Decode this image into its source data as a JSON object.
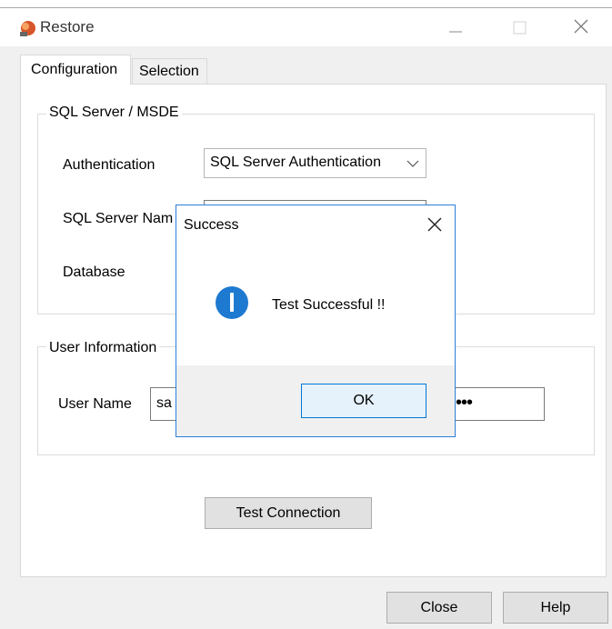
{
  "window": {
    "title": "Restore"
  },
  "tabs": {
    "configuration": "Configuration",
    "selection": "Selection"
  },
  "sql_group": {
    "title": "SQL Server / MSDE",
    "auth_label": "Authentication",
    "auth_value": "SQL Server Authentication",
    "server_label": "SQL Server Nam",
    "database_label": "Database"
  },
  "user_group": {
    "title": "User Information",
    "username_label": "User Name",
    "username_value": "sa",
    "password_value": "•••"
  },
  "buttons": {
    "test_connection": "Test Connection",
    "close": "Close",
    "help": "Help"
  },
  "dialog": {
    "title": "Success",
    "message": "Test Successful !!",
    "ok": "OK"
  },
  "colors": {
    "dialog_border": "#2b7fd6",
    "info_icon": "#1e7ad0",
    "ok_button_border": "#0078d7"
  }
}
